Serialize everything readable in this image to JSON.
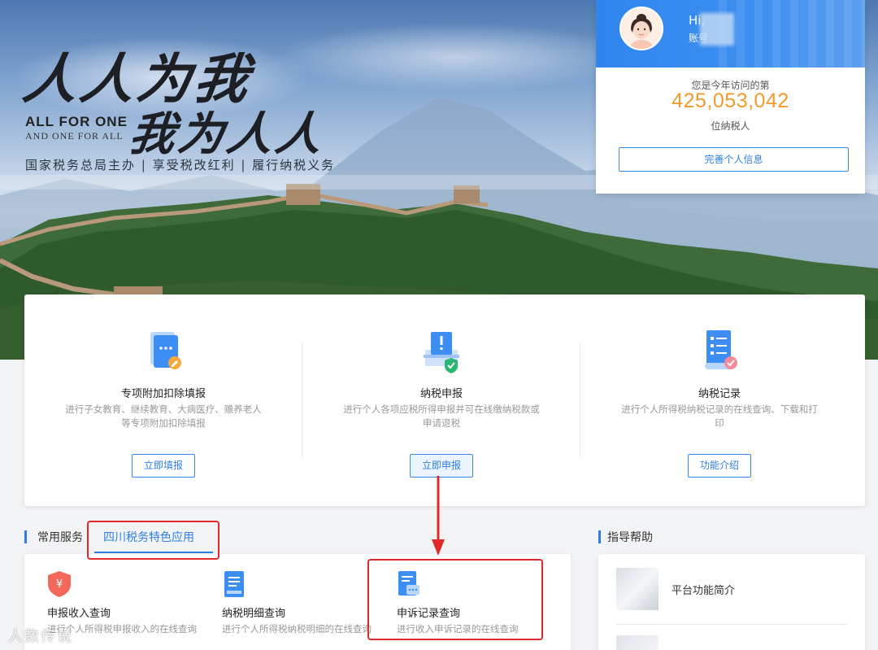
{
  "banner": {
    "calligraphy_line1": "人人为我",
    "calligraphy_line2": "我为人人",
    "english_line1": "ALL FOR ONE",
    "english_line2": "AND ONE FOR ALL",
    "slogan": "国家税务总局主办 | 享受税改红利 | 履行纳税义务"
  },
  "user_card": {
    "greeting": "Hi,",
    "account_label": "账号",
    "visit_prefix": "您是今年访问的第",
    "visit_count": "425,053,042",
    "visit_suffix": "位纳税人",
    "complete_info_button": "完善个人信息",
    "header_color": "#2f86ee",
    "count_color": "#f39a2b"
  },
  "services": [
    {
      "icon": "document-edit-icon",
      "title": "专项附加扣除填报",
      "desc": "进行子女教育、继续教育、大病医疗、赡养老人等专项附加扣除填报",
      "button": "立即填报"
    },
    {
      "icon": "tax-declaration-shield-icon",
      "title": "纳税申报",
      "desc": "进行个人各项应税所得申报并可在线缴纳税款或申请退税",
      "button": "立即申报"
    },
    {
      "icon": "tax-record-checklist-icon",
      "title": "纳税记录",
      "desc": "进行个人所得税纳税记录的在线查询、下载和打印",
      "button": "功能介绍"
    }
  ],
  "sections": {
    "common_services": "常用服务",
    "sichuan_apps": "四川税务特色应用",
    "guide_help": "指导帮助"
  },
  "apps": [
    {
      "icon": "yuan-shield-icon",
      "name": "申报收入查询",
      "sub": "进行个人所得税申报收入的在线查询"
    },
    {
      "icon": "tax-detail-document-icon",
      "name": "纳税明细查询",
      "sub": "进行个人所得税纳税明细的在线查询"
    },
    {
      "icon": "complaint-record-icon",
      "name": "申诉记录查询",
      "sub": "进行收入申诉记录的在线查询"
    }
  ],
  "help": {
    "items": [
      {
        "label": "平台功能简介"
      }
    ]
  },
  "watermark": "人数传说",
  "accent_color": "#2f7fe0",
  "annotation_color": "#e02a2a"
}
